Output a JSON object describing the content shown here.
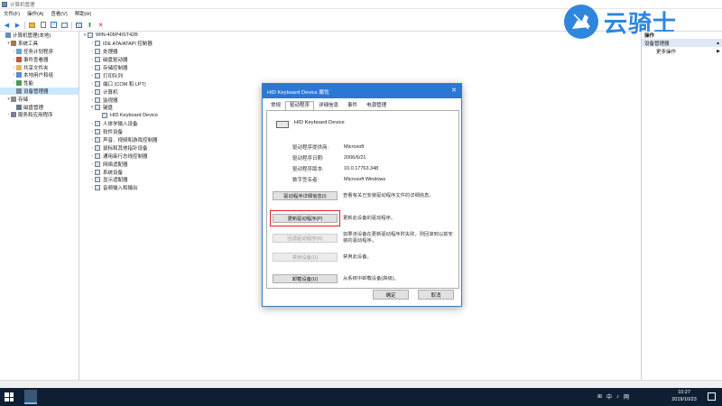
{
  "window": {
    "title": "计算机管理"
  },
  "menu": [
    "文件(F)",
    "操作(A)",
    "查看(V)",
    "帮助(H)"
  ],
  "toolbar": [
    "back-icon",
    "forward-icon",
    "up-icon",
    "properties-icon",
    "help-icon",
    "show-hide-icon",
    "computer-icon",
    "update-driver-icon",
    "uninstall-icon"
  ],
  "left_tree": [
    {
      "label": "计算机管理(本地)",
      "indent": 0,
      "exp": "",
      "icon": "computer-icon",
      "color": "#6b8fb5"
    },
    {
      "label": "系统工具",
      "indent": 1,
      "exp": "▾",
      "icon": "tools-icon",
      "color": "#a57b3a"
    },
    {
      "label": "任务计划程序",
      "indent": 2,
      "exp": "›",
      "icon": "clock-icon",
      "color": "#6aa0d8"
    },
    {
      "label": "事件查看器",
      "indent": 2,
      "exp": "›",
      "icon": "event-icon",
      "color": "#c9503c"
    },
    {
      "label": "共享文件夹",
      "indent": 2,
      "exp": "›",
      "icon": "folder-icon",
      "color": "#e6b84a"
    },
    {
      "label": "本地用户和组",
      "indent": 2,
      "exp": "›",
      "icon": "users-icon",
      "color": "#5b8ac8"
    },
    {
      "label": "性能",
      "indent": 2,
      "exp": "›",
      "icon": "performance-icon",
      "color": "#4a9a5a"
    },
    {
      "label": "设备管理器",
      "indent": 2,
      "exp": "",
      "icon": "device-manager-icon",
      "color": "#7b8a99",
      "selected": true
    },
    {
      "label": "存储",
      "indent": 1,
      "exp": "▾",
      "icon": "storage-icon",
      "color": "#8a8a8a"
    },
    {
      "label": "磁盘管理",
      "indent": 2,
      "exp": "",
      "icon": "disk-icon",
      "color": "#6c7b8b"
    },
    {
      "label": "服务和应用程序",
      "indent": 1,
      "exp": "›",
      "icon": "services-icon",
      "color": "#7b7b9b"
    }
  ],
  "device_tree": [
    {
      "label": "WIN-405P4IST42B",
      "indent": 0,
      "exp": "▾",
      "icon": "computer-icon"
    },
    {
      "label": "IDE ATA/ATAPI 控制器",
      "indent": 1,
      "exp": "›",
      "icon": "ide-controller-icon"
    },
    {
      "label": "处理器",
      "indent": 1,
      "exp": "›",
      "icon": "processor-icon"
    },
    {
      "label": "磁盘驱动器",
      "indent": 1,
      "exp": "›",
      "icon": "disk-drive-icon"
    },
    {
      "label": "存储控制器",
      "indent": 1,
      "exp": "›",
      "icon": "storage-controller-icon"
    },
    {
      "label": "打印队列",
      "indent": 1,
      "exp": "›",
      "icon": "printer-icon"
    },
    {
      "label": "端口 (COM 和 LPT)",
      "indent": 1,
      "exp": "›",
      "icon": "port-icon"
    },
    {
      "label": "计算机",
      "indent": 1,
      "exp": "›",
      "icon": "computer-icon"
    },
    {
      "label": "监视器",
      "indent": 1,
      "exp": "›",
      "icon": "monitor-icon"
    },
    {
      "label": "键盘",
      "indent": 1,
      "exp": "▾",
      "icon": "keyboard-icon"
    },
    {
      "label": "HID Keyboard Device",
      "indent": 2,
      "exp": "",
      "icon": "keyboard-icon"
    },
    {
      "label": "人体学输入设备",
      "indent": 1,
      "exp": "›",
      "icon": "hid-icon"
    },
    {
      "label": "软件设备",
      "indent": 1,
      "exp": "›",
      "icon": "software-device-icon"
    },
    {
      "label": "声音、视频和游戏控制器",
      "indent": 1,
      "exp": "›",
      "icon": "sound-icon"
    },
    {
      "label": "鼠标和其他指针设备",
      "indent": 1,
      "exp": "›",
      "icon": "mouse-icon"
    },
    {
      "label": "通用串行总线控制器",
      "indent": 1,
      "exp": "›",
      "icon": "usb-icon"
    },
    {
      "label": "网络适配器",
      "indent": 1,
      "exp": "›",
      "icon": "network-icon"
    },
    {
      "label": "系统设备",
      "indent": 1,
      "exp": "›",
      "icon": "system-device-icon"
    },
    {
      "label": "显示适配器",
      "indent": 1,
      "exp": "›",
      "icon": "display-adapter-icon"
    },
    {
      "label": "音频输入和输出",
      "indent": 1,
      "exp": "›",
      "icon": "audio-icon"
    }
  ],
  "actions": {
    "header": "操作",
    "group": "设备管理器",
    "more": "更多操作"
  },
  "logo": {
    "text": "云骑士"
  },
  "dialog": {
    "title": "HID Keyboard Device 属性",
    "tabs": [
      "常规",
      "驱动程序",
      "详细信息",
      "事件",
      "电源管理"
    ],
    "active_tab": 1,
    "device_name": "HID Keyboard Device",
    "props": [
      {
        "k": "驱动程序提供商:",
        "v": "Microsoft"
      },
      {
        "k": "驱动程序日期:",
        "v": "2006/6/21"
      },
      {
        "k": "驱动程序版本:",
        "v": "10.0.17763.348"
      },
      {
        "k": "数字签名者:",
        "v": "Microsoft Windows"
      }
    ],
    "buttons": [
      {
        "label": "驱动程序详细信息(I)",
        "desc": "查看有关已安装驱动程序文件的详细信息。",
        "disabled": false
      },
      {
        "label": "更新驱动程序(P)",
        "desc": "更新此设备的驱动程序。",
        "disabled": false,
        "highlight": true
      },
      {
        "label": "回退驱动程序(R)",
        "desc": "如果该设备在更新驱动程序时失败，则回滚到以前安装的驱动程序。",
        "disabled": true
      },
      {
        "label": "禁用设备(D)",
        "desc": "禁用此设备。",
        "disabled": true
      },
      {
        "label": "卸载设备(U)",
        "desc": "从系统中卸载设备(高级)。",
        "disabled": false
      }
    ],
    "ok": "确定",
    "cancel": "取消"
  },
  "taskbar": {
    "tray": [
      "⊞",
      "中",
      "♪",
      "网"
    ],
    "time": "10:27",
    "date": "2019/10/23"
  },
  "colors": {
    "accent": "#2b78d4",
    "highlight": "#e0242b",
    "taskbar": "#0f1f33"
  }
}
